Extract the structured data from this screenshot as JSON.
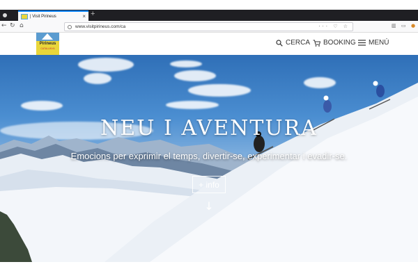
{
  "browser": {
    "tab_title": "| Visit Pirineus",
    "tab_close": "×",
    "new_tab": "+",
    "url": "www.visitpirineus.com/ca",
    "url_actions": "··· ♡ ☆",
    "nav_back": "←",
    "nav_forward": "→",
    "nav_reload": "↻",
    "nav_home": "⌂",
    "library_icon": "library-icon",
    "sidebar_icon": "sidebar-icon",
    "extension_icon": "extension-icon"
  },
  "site": {
    "logo_text": "Pirineus",
    "logo_sub": "CATALUNYA",
    "menu": [
      {
        "label": "CERCA",
        "icon": "search-icon"
      },
      {
        "label": "BOOKING",
        "icon": "cart-icon"
      },
      {
        "label": "MENÚ",
        "icon": "hamburger-icon"
      }
    ]
  },
  "hero": {
    "title": "NEU I AVENTURA",
    "subtitle": "Emocions per exprimir el temps, divertir-se, experimentar i evadir-se.",
    "button": "+ info",
    "scroll_icon": "arrow-down-icon"
  }
}
